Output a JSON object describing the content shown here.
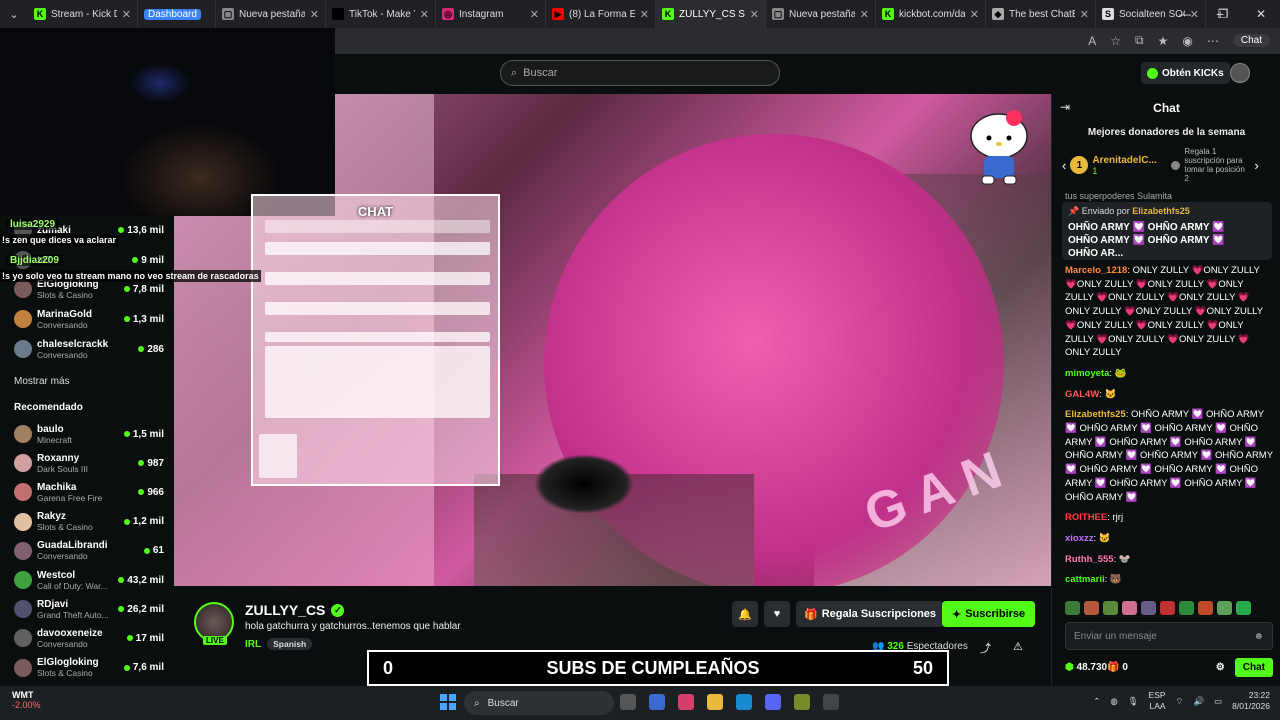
{
  "tabs": [
    {
      "label": "Stream - Kick Dash",
      "fav": "K",
      "color": "#53fc18"
    },
    {
      "label": "Dashboard",
      "fav": "",
      "color": "#3b82f6"
    },
    {
      "label": "Nueva pestaña",
      "fav": "▢",
      "color": "#888"
    },
    {
      "label": "TikTok - Make Your",
      "fav": "♪",
      "color": "#000"
    },
    {
      "label": "Instagram",
      "fav": "◎",
      "color": "#d62976"
    },
    {
      "label": "(8) La Forma En Q",
      "fav": "▶",
      "color": "#ff0000"
    },
    {
      "label": "ZULLYY_CS Str",
      "fav": "K",
      "color": "#53fc18"
    },
    {
      "label": "Nueva pestaña",
      "fav": "▢",
      "color": "#888"
    },
    {
      "label": "kickbot.com/dashb",
      "fav": "K",
      "color": "#53fc18"
    },
    {
      "label": "The best ChatBot a",
      "fav": "◆",
      "color": "#aaa"
    },
    {
      "label": "Socialteen SOCIAL",
      "fav": "S",
      "color": "#ddd"
    }
  ],
  "browser": {
    "chat_label": "Chat",
    "new_tab": "+"
  },
  "topnav": {
    "search_placeholder": "Buscar",
    "kicks_label": "Obtén KICKs"
  },
  "alerts": [
    {
      "name": "luisa2929",
      "text": "!s zen que dices va aclarar"
    },
    {
      "name": "Bjjdiaz209",
      "text": "!s yo solo veo tu stream mano no veo stream de rascadoras"
    }
  ],
  "sidebar": {
    "partial": [
      {
        "name": "zumaki",
        "viewers": "13,6 mil"
      },
      {
        "name": "ta7",
        "viewers": "9 mil"
      }
    ],
    "following": [
      {
        "name": "ElGlogloking",
        "cat": "Slots & Casino",
        "viewers": "7,8 mil",
        "color": "#7a5a5a"
      },
      {
        "name": "MarinaGold",
        "cat": "Conversando",
        "viewers": "1,3 mil",
        "color": "#c08040"
      },
      {
        "name": "chaleselcrackk",
        "cat": "Conversando",
        "viewers": "286",
        "color": "#6a7a8a"
      }
    ],
    "show_more": "Mostrar más",
    "recommended_title": "Recomendado",
    "recommended": [
      {
        "name": "baulo",
        "cat": "Minecraft",
        "viewers": "1,5 mil",
        "color": "#a08060"
      },
      {
        "name": "Roxanny",
        "cat": "Dark Souls III",
        "viewers": "987",
        "color": "#d0a0a0"
      },
      {
        "name": "Machika",
        "cat": "Garena Free Fire",
        "viewers": "966",
        "color": "#c07070"
      },
      {
        "name": "Rakyz",
        "cat": "Slots & Casino",
        "viewers": "1,2 mil",
        "color": "#e0c0a0"
      },
      {
        "name": "GuadaLibrandi",
        "cat": "Conversando",
        "viewers": "61",
        "color": "#806070"
      },
      {
        "name": "Westcol",
        "cat": "Call of Duty: War...",
        "viewers": "43,2 mil",
        "color": "#40a040"
      },
      {
        "name": "RDjavi",
        "cat": "Grand Theft Auto...",
        "viewers": "26,2 mil",
        "color": "#505070"
      },
      {
        "name": "davooxeneize",
        "cat": "Conversando",
        "viewers": "17 mil",
        "color": "#606060"
      },
      {
        "name": "ElGlogloking",
        "cat": "Slots & Casino",
        "viewers": "7,6 mil",
        "color": "#7a5a5a"
      }
    ]
  },
  "overlay": {
    "title": "CHAT"
  },
  "stream": {
    "name": "ZULLYY_CS",
    "title": "hola gatchurra y gatchurros..tenemos que hablar",
    "category": "IRL",
    "language": "Spanish",
    "live": "LIVE",
    "regala_label": "Regala Suscripciones",
    "subscribe_label": "Suscribirse",
    "viewers": "326",
    "viewers_label": "Espectadores"
  },
  "subs_bar": {
    "left": "0",
    "title": "SUBS DE CUMPLEAÑOS",
    "right": "50"
  },
  "chat": {
    "title": "Chat",
    "donors_title": "Mejores donadores de la semana",
    "donor_name": "ArenitadelC...",
    "donor_rank": "1",
    "donor_count": "1",
    "gift_hint": "Regala 1 suscripción para tomar la posición 2",
    "partial_line": "tus superpoderes Sulamita",
    "pinned_by": "Enviado por",
    "pinned_user": "Elizabethfs25",
    "pinned_text": "OHÑO ARMY 💟 OHÑO ARMY 💟 OHÑO ARMY 💟 OHÑO ARMY 💟 OHÑO AR...",
    "messages": [
      {
        "user": "Marcelo_1218",
        "color": "#ff8a3d",
        "text": "ONLY ZULLY 💗ONLY ZULLY 💗ONLY ZULLY 💗ONLY ZULLY 💗ONLY ZULLY 💗ONLY ZULLY 💗ONLY ZULLY 💗ONLY ZULLY 💗ONLY ZULLY 💗ONLY ZULLY 💗ONLY ZULLY 💗ONLY ZULLY 💗ONLY ZULLY 💗ONLY ZULLY 💗ONLY ZULLY 💗ONLY ZULLY"
      },
      {
        "user": "mimoyeta",
        "color": "#53fc18",
        "text": "🐸"
      },
      {
        "user": "GAL4W",
        "color": "#ff5a5a",
        "text": "🐱"
      },
      {
        "user": "Elizabethfs25",
        "color": "#e8b93a",
        "text": "OHÑO ARMY 💟 OHÑO ARMY 💟 OHÑO ARMY 💟 OHÑO ARMY 💟 OHÑO ARMY 💟 OHÑO ARMY 💟 OHÑO ARMY 💟 OHÑO ARMY 💟 OHÑO ARMY 💟 OHÑO ARMY 💟 OHÑO ARMY 💟 OHÑO ARMY 💟 OHÑO ARMY 💟 OHÑO ARMY 💟 OHÑO ARMY 💟 OHÑO ARMY 💟"
      },
      {
        "user": "ROITHEE",
        "color": "#ff4040",
        "text": "rjrj"
      },
      {
        "user": "xioxzz",
        "color": "#c070ff",
        "text": "🐱"
      },
      {
        "user": "Ruthh_555",
        "color": "#ff7ab0",
        "text": "🐭"
      },
      {
        "user": "cattmarii",
        "color": "#53fc18",
        "text": "🐻"
      }
    ],
    "input_placeholder": "Enviar un mensaje",
    "points": "48.730",
    "gifts": "0",
    "send_label": "Chat"
  },
  "taskbar": {
    "weather_temp": "WMT",
    "weather_change": "-2.00%",
    "search": "Buscar",
    "lang1": "ESP",
    "lang2": "LAA",
    "time": "23:22",
    "date": "8/01/2026"
  }
}
